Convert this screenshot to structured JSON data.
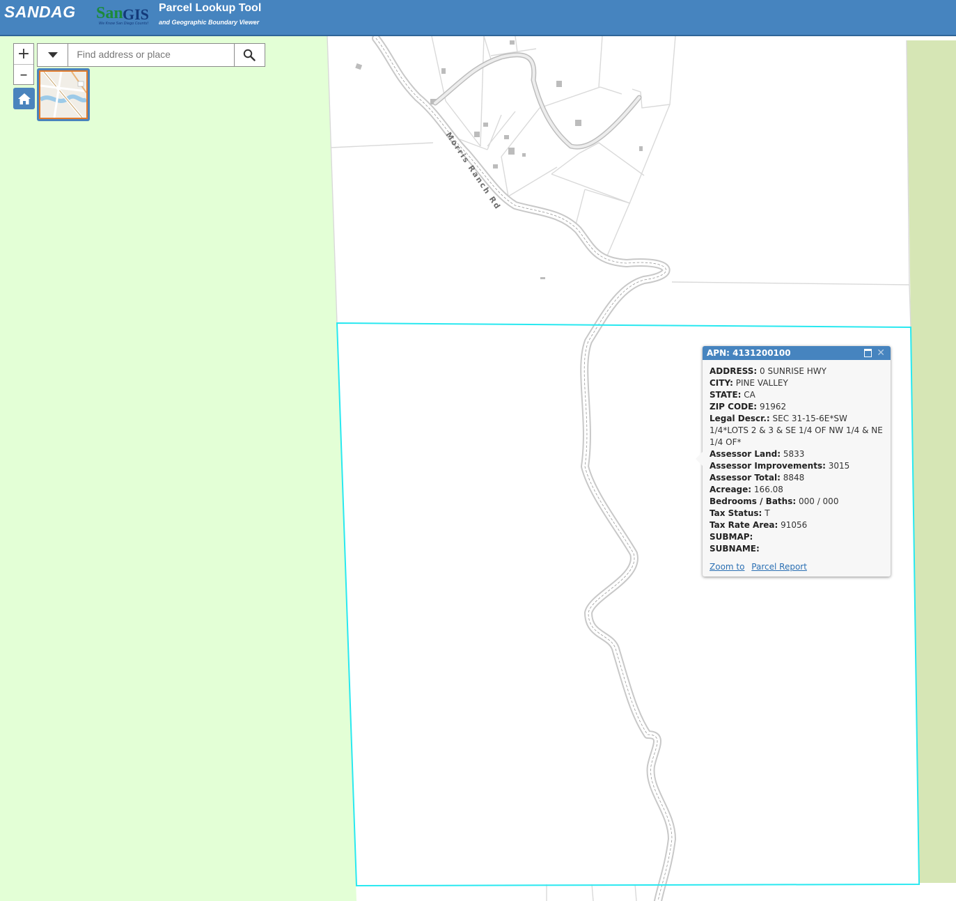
{
  "header": {
    "org_logo": "SANDAG",
    "partner_logo_san": "San",
    "partner_logo_gis": "GIS",
    "partner_tagline": "We Know San Diego Counts!",
    "title": "Parcel Lookup Tool",
    "subtitle": "and Geographic Boundary Viewer"
  },
  "map": {
    "street_label": "Morris Ranch Rd",
    "colors": {
      "open_space_left": "#e3ffd6",
      "open_space_right": "#d6e6b5",
      "parcel_line": "#d9d9d9",
      "selected_parcel": "#28e8f0",
      "road_casing": "#c2c2c2"
    }
  },
  "controls": {
    "zoom_in_label": "+",
    "zoom_out_label": "–",
    "home_icon": "home-icon",
    "search_placeholder": "Find address or place"
  },
  "popup": {
    "title": "APN: 4131200100",
    "fields": [
      {
        "label": "ADDRESS:",
        "value": "0 SUNRISE HWY"
      },
      {
        "label": "CITY:",
        "value": "PINE VALLEY"
      },
      {
        "label": "STATE:",
        "value": "CA"
      },
      {
        "label": "ZIP CODE:",
        "value": "91962"
      },
      {
        "label": "Legal Descr.:",
        "value": "SEC 31-15-6E*SW 1/4*LOTS 2 & 3 & SE 1/4 OF NW 1/4 & NE 1/4 OF*"
      },
      {
        "label": "Assessor Land:",
        "value": "5833"
      },
      {
        "label": "Assessor Improvements:",
        "value": "3015"
      },
      {
        "label": "Assessor Total:",
        "value": "8848"
      },
      {
        "label": "Acreage:",
        "value": "166.08"
      },
      {
        "label": "Bedrooms / Baths:",
        "value": "000 / 000"
      },
      {
        "label": "Tax Status:",
        "value": "T"
      },
      {
        "label": "Tax Rate Area:",
        "value": "91056"
      },
      {
        "label": "SUBMAP:",
        "value": ""
      },
      {
        "label": "SUBNAME:",
        "value": ""
      }
    ],
    "zoom_link": "Zoom to",
    "report_link": "Parcel Report"
  }
}
